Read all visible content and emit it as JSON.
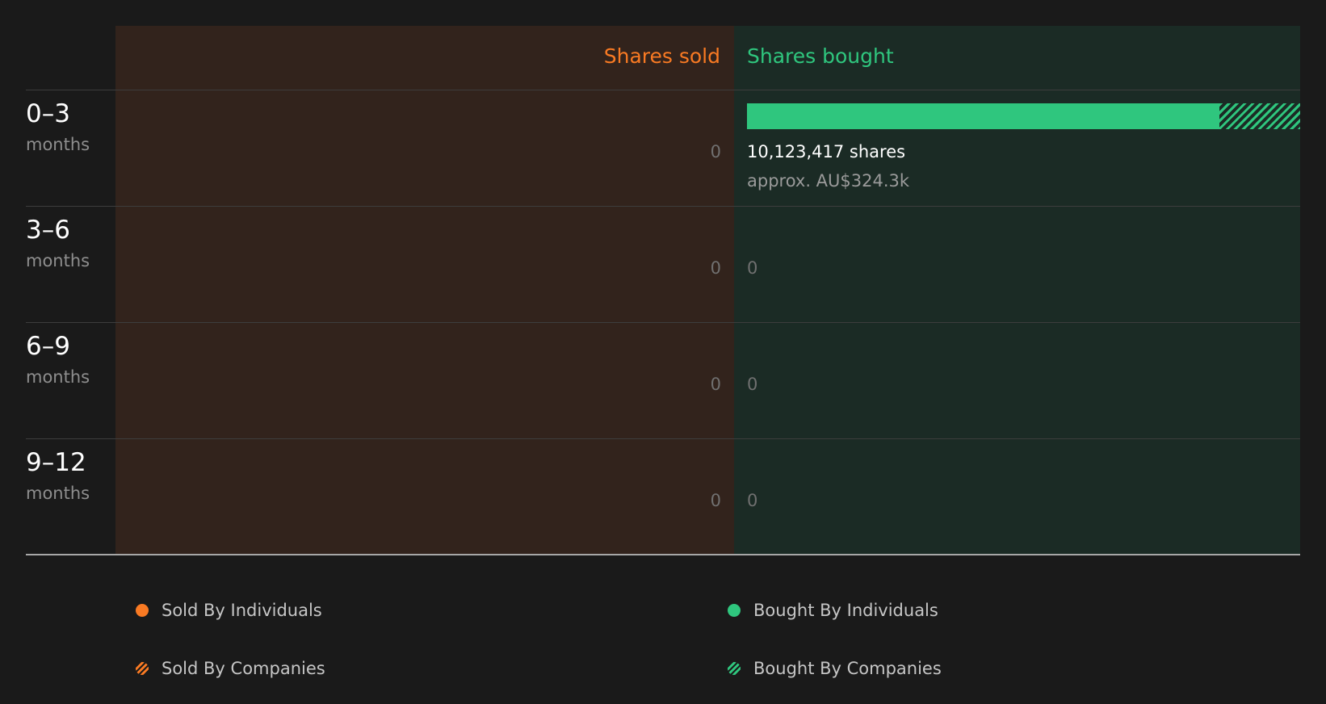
{
  "chart_data": {
    "type": "bar",
    "orientation": "horizontal-diverging",
    "headers": {
      "sold": "Shares sold",
      "bought": "Shares bought"
    },
    "categories": [
      {
        "range": "0–3",
        "unit": "months"
      },
      {
        "range": "3–6",
        "unit": "months"
      },
      {
        "range": "6–9",
        "unit": "months"
      },
      {
        "range": "9–12",
        "unit": "months"
      }
    ],
    "series": [
      {
        "name": "Sold By Individuals",
        "values": [
          0,
          0,
          0,
          0
        ]
      },
      {
        "name": "Sold By Companies",
        "values": [
          0,
          0,
          0,
          0
        ]
      },
      {
        "name": "Bought By Individuals",
        "values": [
          8650000,
          0,
          0,
          0
        ]
      },
      {
        "name": "Bought By Companies",
        "values": [
          1473417,
          0,
          0,
          0
        ]
      }
    ],
    "totals": {
      "sold": [
        0,
        0,
        0,
        0
      ],
      "bought": [
        10123417,
        0,
        0,
        0
      ]
    },
    "value_labels": {
      "sold": [
        "0",
        "0",
        "0",
        "0"
      ],
      "bought": [
        "10,123,417 shares",
        "0",
        "0",
        "0"
      ],
      "bought_value": [
        "approx. AU$324.3k",
        "",
        "",
        ""
      ]
    },
    "legend": [
      {
        "label": "Sold By Individuals",
        "pattern": "solid",
        "color": "#f97a23"
      },
      {
        "label": "Bought By Individuals",
        "pattern": "solid",
        "color": "#2fc67e"
      },
      {
        "label": "Sold By Companies",
        "pattern": "hatched",
        "color": "#f97a23"
      },
      {
        "label": "Bought By Companies",
        "pattern": "hatched",
        "color": "#2fc67e"
      }
    ],
    "legend_placement": "bottom"
  },
  "colors": {
    "sold": "#f97a23",
    "bought": "#2fc67e",
    "sold_panel": "#32231c",
    "bought_panel": "#1b2b25",
    "background": "#1a1a1a"
  }
}
